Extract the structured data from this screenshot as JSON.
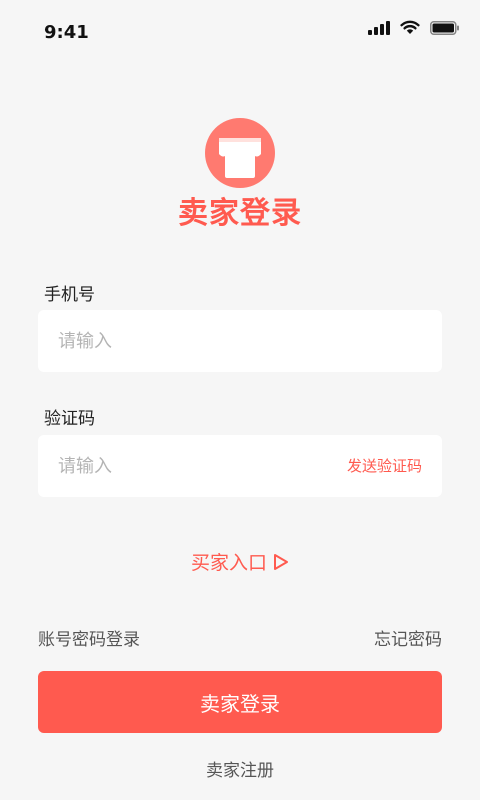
{
  "status_bar": {
    "time": "9:41"
  },
  "brand": {
    "title": "卖家登录",
    "accent_color": "#ff5a4f"
  },
  "phone_field": {
    "label": "手机号",
    "placeholder": "请输入",
    "value": ""
  },
  "code_field": {
    "label": "验证码",
    "placeholder": "请输入",
    "value": "",
    "send_code_label": "发送验证码"
  },
  "links": {
    "buyer_entry": "买家入口",
    "password_login": "账号密码登录",
    "forgot_password": "忘记密码",
    "register": "卖家注册"
  },
  "login_button": {
    "label": "卖家登录"
  },
  "icons": {
    "signal": "cellular-signal-icon",
    "wifi": "wifi-icon",
    "battery": "battery-icon",
    "store": "store-awning-icon",
    "arrow": "play-triangle-icon"
  }
}
